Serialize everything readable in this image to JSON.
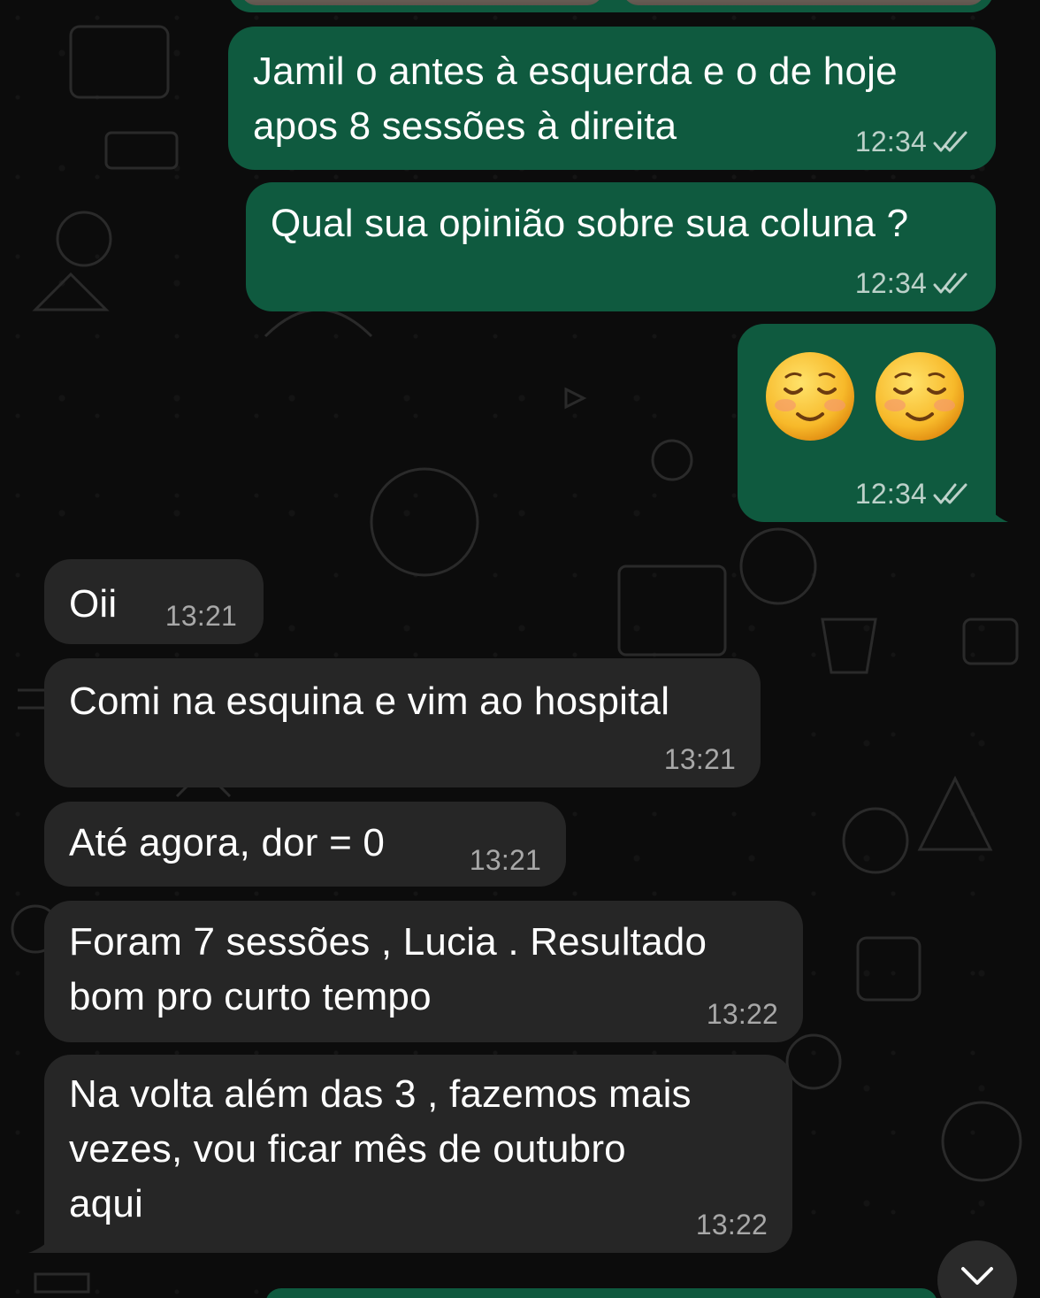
{
  "colors": {
    "outgoing_bubble": "#0f5a3f",
    "incoming_bubble": "#262626",
    "background": "#0b0b0b"
  },
  "messages": [
    {
      "direction": "out",
      "text": "Jamil o antes à esquerda e o de hoje\napos 8 sessões à direita",
      "time": "12:34",
      "status": "read"
    },
    {
      "direction": "out",
      "text": "Qual sua opinião sobre sua coluna ?",
      "time": "12:34",
      "status": "read"
    },
    {
      "direction": "out",
      "emoji": [
        "☺️",
        "☺️"
      ],
      "time": "12:34",
      "status": "read"
    },
    {
      "direction": "in",
      "text": "Oii",
      "time": "13:21"
    },
    {
      "direction": "in",
      "text": "Comi na esquina e vim ao hospital",
      "time": "13:21"
    },
    {
      "direction": "in",
      "text": "Até agora, dor = 0",
      "time": "13:21"
    },
    {
      "direction": "in",
      "text": "Foram 7 sessões , Lucia . Resultado\nbom pro curto tempo",
      "time": "13:22"
    },
    {
      "direction": "in",
      "text": "Na volta além das 3 , fazemos mais\nvezes, vou ficar mês de outubro\naqui",
      "time": "13:22"
    }
  ],
  "icons": {
    "read_receipt": "double-check-icon",
    "scroll_down": "chevron-down-icon",
    "emoji": "smiling-face-icon"
  }
}
